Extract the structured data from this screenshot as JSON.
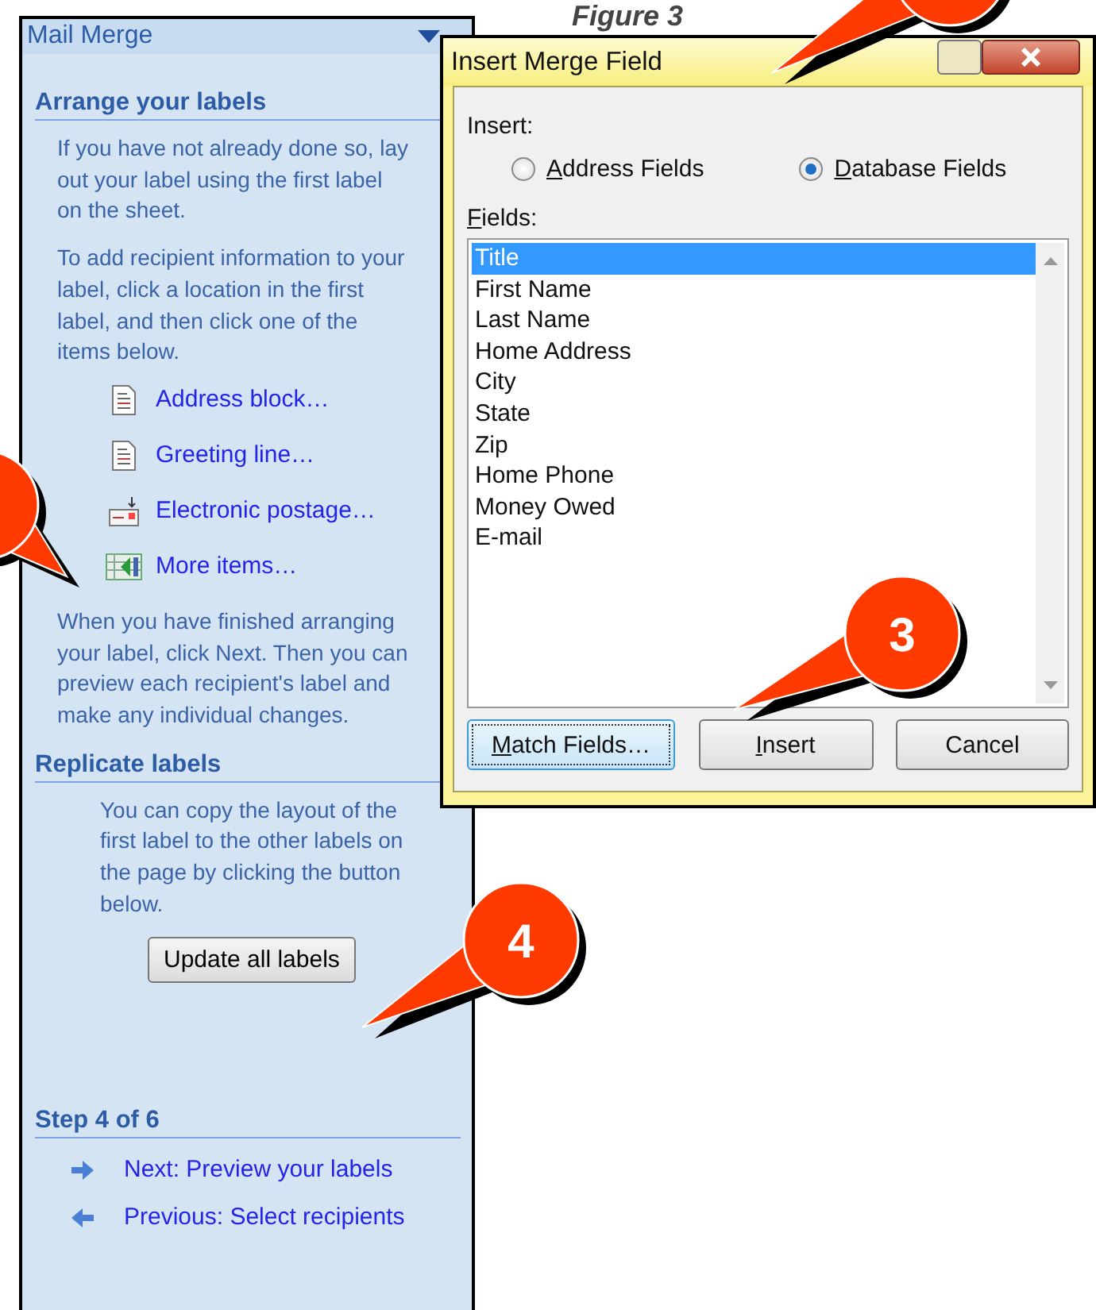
{
  "caption": "Figure 3",
  "task_pane": {
    "title": "Mail Merge",
    "blocks": [
      {
        "kind": "heading",
        "text": "Arrange your labels"
      },
      {
        "kind": "paragraph",
        "text": "If you have not already done so, lay out your label using the first label on the sheet."
      },
      {
        "kind": "paragraph",
        "text": "To add recipient information to your label, click a location in the first label, and then click one of the items below."
      },
      {
        "kind": "doclink",
        "text": "Address block…"
      },
      {
        "kind": "doclink",
        "text": "Greeting line…"
      },
      {
        "kind": "postagelink",
        "text": "Electronic postage…"
      },
      {
        "kind": "gridlink",
        "text": "More items…"
      },
      {
        "kind": "paragraph",
        "text": "When you have finished arranging your label, click Next. Then you can preview each recipient's label and make any individual changes."
      },
      {
        "kind": "heading",
        "text": "Replicate labels"
      },
      {
        "kind": "note",
        "text": "You can copy the layout of the first label to the other labels on the page by clicking the button below."
      },
      {
        "kind": "button",
        "text": "Update all labels"
      },
      {
        "kind": "heading",
        "text": "Step 4 of 6"
      },
      {
        "kind": "nextlink",
        "text": "Next: Preview your labels"
      },
      {
        "kind": "previouslink",
        "text": "Previous: Select recipients"
      }
    ]
  },
  "dialog": {
    "title": "Insert Merge Field",
    "insert_label": "Insert:",
    "radios": [
      {
        "label": "Address Fields",
        "access_key": true,
        "selected": false
      },
      {
        "label": "Database Fields",
        "access_key": true,
        "selected": true
      }
    ],
    "fields_label": "Fields:",
    "fields_access_key": true,
    "fields": [
      {
        "label": "Title",
        "selected": true
      },
      {
        "label": "First Name",
        "selected": false
      },
      {
        "label": "Last Name",
        "selected": false
      },
      {
        "label": "Home Address",
        "selected": false
      },
      {
        "label": "City",
        "selected": false
      },
      {
        "label": "State",
        "selected": false
      },
      {
        "label": "Zip",
        "selected": false
      },
      {
        "label": "Home Phone",
        "selected": false
      },
      {
        "label": "Money Owed",
        "selected": false
      },
      {
        "label": "E-mail",
        "selected": false
      }
    ],
    "buttons": [
      {
        "label": "Match Fields…",
        "access_key": true,
        "focused": true
      },
      {
        "label": "Insert",
        "access_key": true,
        "focused": false
      },
      {
        "label": "Cancel",
        "access_key": false,
        "focused": false
      }
    ]
  },
  "callouts": [
    {
      "kind": "partial"
    },
    {
      "kind": "partial"
    },
    {
      "kind": "numbered",
      "number": "3"
    },
    {
      "kind": "numbered",
      "number": "4"
    }
  ]
}
